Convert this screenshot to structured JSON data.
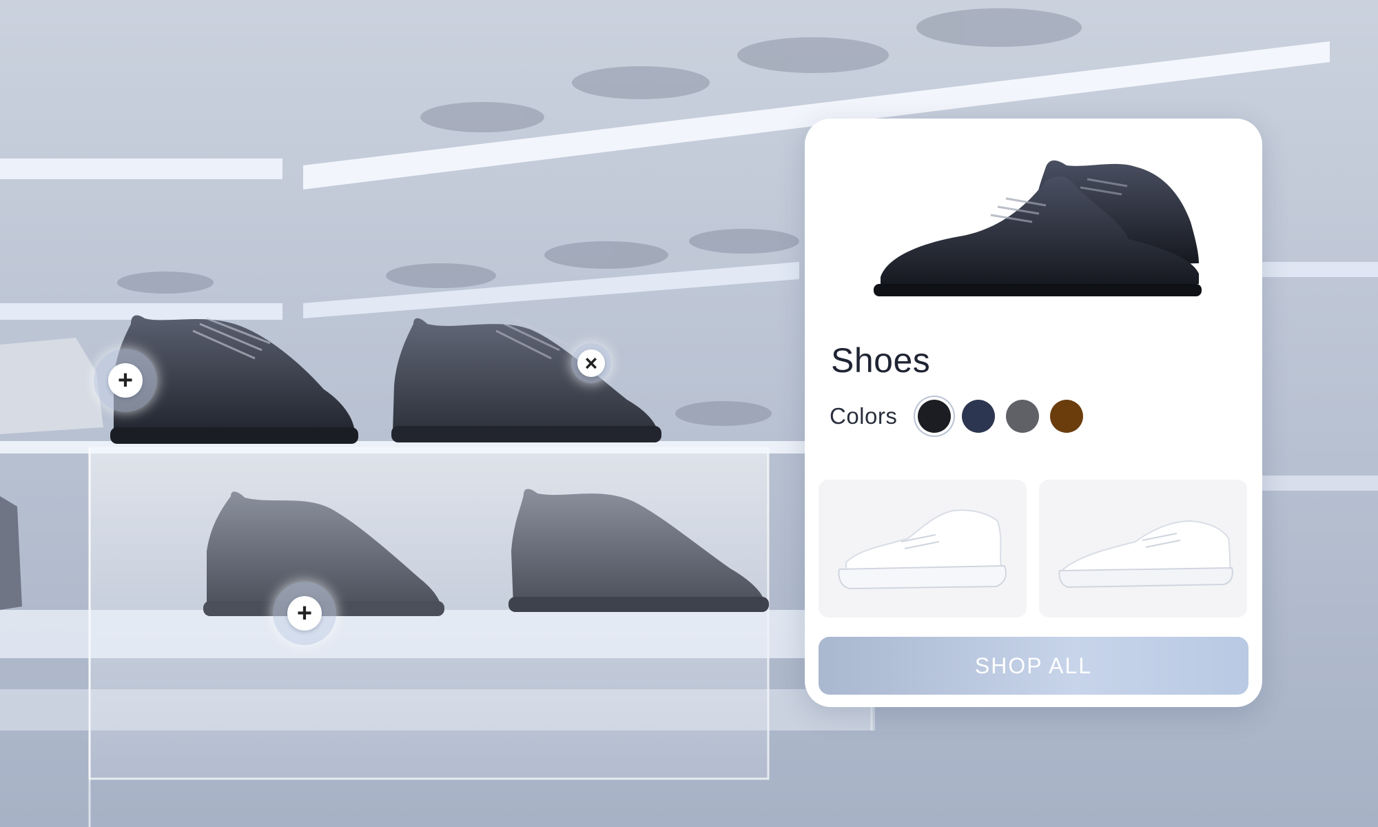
{
  "product_card": {
    "title": "Shoes",
    "colors_label": "Colors",
    "colors": [
      {
        "name": "black",
        "hex": "#1c1d22",
        "selected": true
      },
      {
        "name": "navy",
        "hex": "#2c3650",
        "selected": false
      },
      {
        "name": "gray",
        "hex": "#5f6166",
        "selected": false
      },
      {
        "name": "brown",
        "hex": "#6b3d0d",
        "selected": false
      }
    ],
    "thumbnails": [
      {
        "name": "white-chunky-sneaker"
      },
      {
        "name": "white-low-sneaker"
      }
    ],
    "shop_button_label": "SHOP ALL"
  },
  "hotspots": [
    {
      "name": "add-hotspot-top-left",
      "icon": "plus-icon",
      "glyph": "+"
    },
    {
      "name": "close-hotspot-top",
      "icon": "close-icon",
      "glyph": "×"
    },
    {
      "name": "add-hotspot-bottom",
      "icon": "plus-icon",
      "glyph": "+"
    }
  ]
}
